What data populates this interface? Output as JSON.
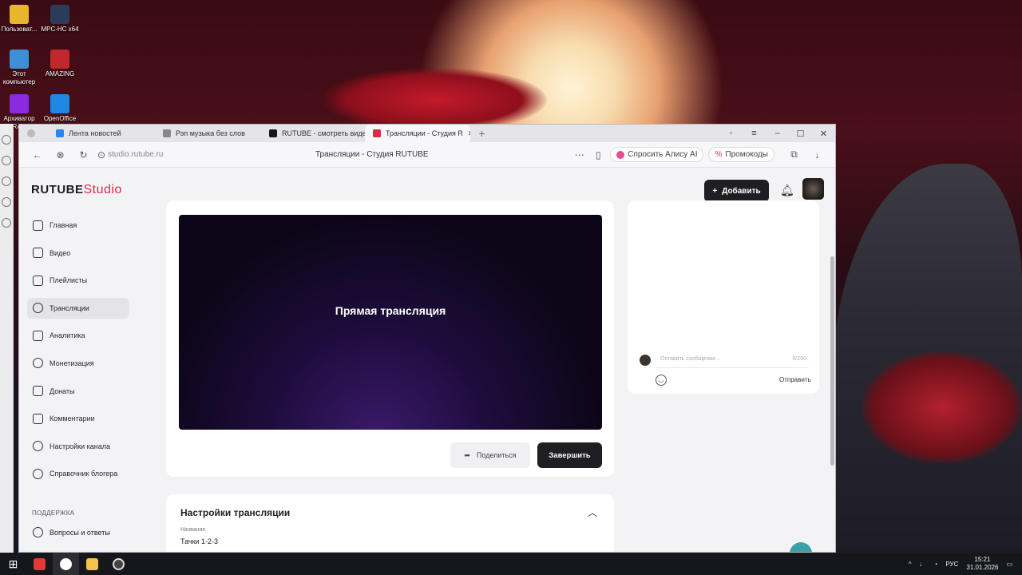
{
  "desktop": {
    "icons": [
      {
        "label": "Пользоват...",
        "icon": "user-folder-icon",
        "color": "#e8b62a"
      },
      {
        "label": "MPC-HC x64",
        "icon": "mpc-hc-icon",
        "color": "#2c3c58"
      },
      {
        "label": "Этот компьютер",
        "icon": "this-pc-icon",
        "color": "#3f8fd8"
      },
      {
        "label": "AMAZING",
        "icon": "amazing-app-icon",
        "color": "#c1272d"
      },
      {
        "label": "Архиватор RAR",
        "icon": "winrar-icon",
        "color": "#8a2be2"
      },
      {
        "label": "OpenOffice",
        "icon": "openoffice-icon",
        "color": "#1e88e5"
      }
    ]
  },
  "browser": {
    "tabs": [
      {
        "label": "Лента новостей",
        "icon": "vk-icon",
        "color": "#2787f5"
      },
      {
        "label": "Рэп музыка без слов",
        "icon": "music-icon",
        "color": "#888888"
      },
      {
        "label": "RUTUBE - смотреть виде",
        "icon": "rutube-icon",
        "color": "#14191f"
      },
      {
        "label": "Трансляции - Студия R",
        "icon": "rutube-studio-icon",
        "color": "#d82d44"
      }
    ],
    "url": "studio.rutube.ru",
    "page_title": "Трансляции - Студия RUTUBE",
    "alice_label": "Спросить Алису AI",
    "promo_label": "Промокоды"
  },
  "studio": {
    "logo": "RUTUBE",
    "logo_suffix": "Studio",
    "add_button": "Добавить",
    "nav": [
      {
        "label": "Главная",
        "icon": "home-icon"
      },
      {
        "label": "Видео",
        "icon": "video-icon"
      },
      {
        "label": "Плейлисты",
        "icon": "playlists-icon"
      },
      {
        "label": "Трансляции",
        "icon": "broadcast-icon"
      },
      {
        "label": "Аналитика",
        "icon": "analytics-icon"
      },
      {
        "label": "Монетизация",
        "icon": "monetization-icon"
      },
      {
        "label": "Донаты",
        "icon": "donations-icon"
      },
      {
        "label": "Комментарии",
        "icon": "comments-icon"
      },
      {
        "label": "Настройки канала",
        "icon": "gear-icon"
      },
      {
        "label": "Справочник блогера",
        "icon": "info-icon"
      }
    ],
    "support_section": "ПОДДЕРЖКА",
    "faq_label": "Вопросы и ответы",
    "player_text": "Прямая трансляция",
    "share_button": "Поделиться",
    "end_button": "Завершить",
    "chat": {
      "placeholder": "Оставить сообщение...",
      "counter": "0/200",
      "send_label": "Отправить"
    },
    "settings": {
      "title": "Настройки трансляции",
      "name_label": "Название",
      "name_value": "Тачки 1-2-3"
    }
  },
  "taskbar": {
    "lang": "РУС",
    "time": "15:21",
    "date": "31.01.2026"
  }
}
